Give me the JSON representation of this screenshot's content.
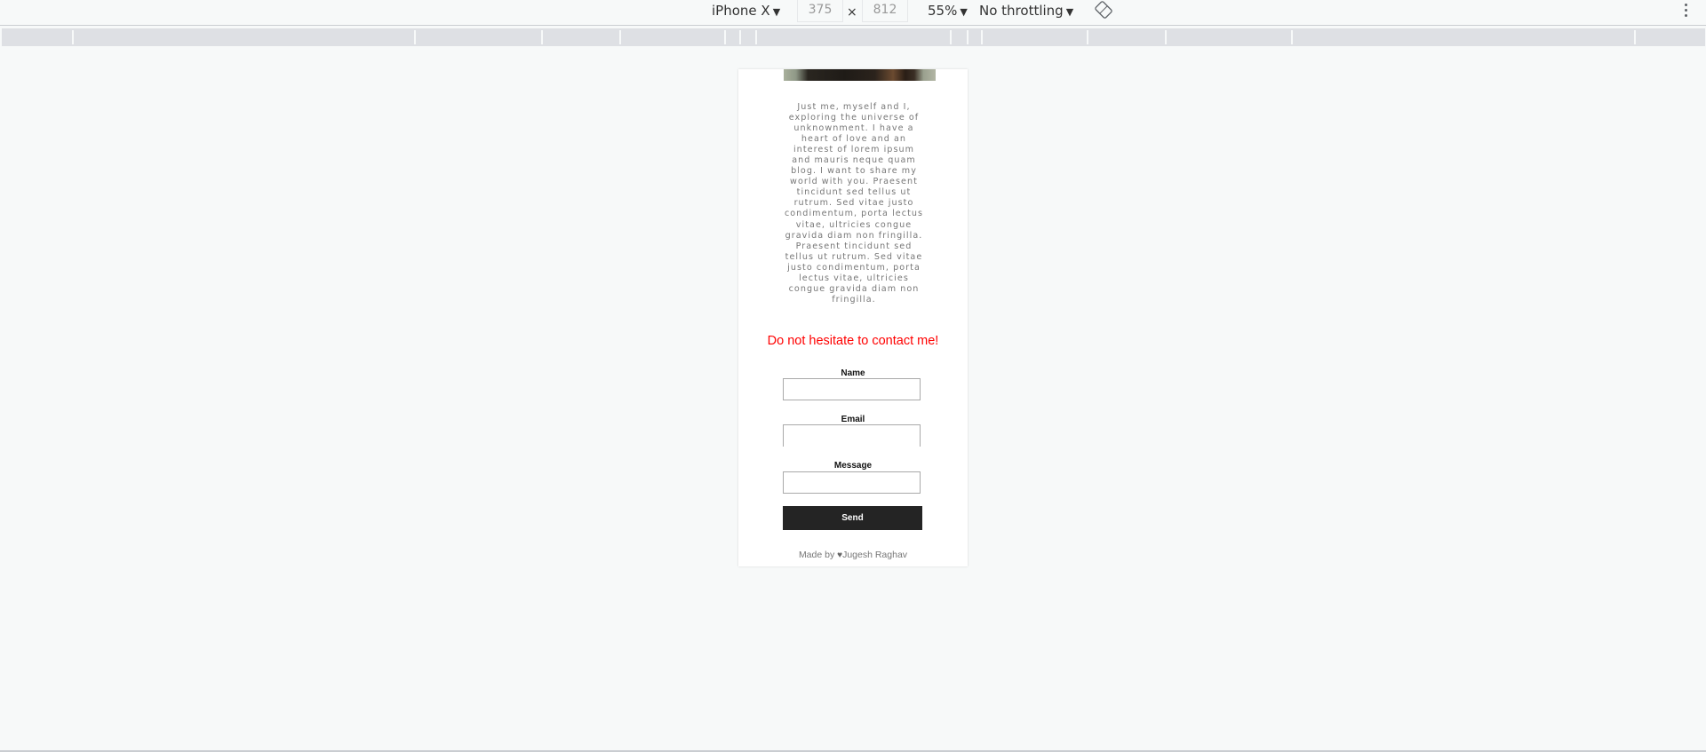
{
  "devtools_toolbar": {
    "device": "iPhone X",
    "width": "375",
    "height": "812",
    "times": "×",
    "zoom": "55%",
    "throttling": "No throttling",
    "caret": "▼",
    "rotate_icon": "rotate-icon",
    "more_icon": "more-vertical-icon"
  },
  "page": {
    "bio": "Just me, myself and I, exploring the universe of unknownment. I have a heart of love and an interest of lorem ipsum and mauris neque quam blog. I want to share my world with you. Praesent tincidunt sed tellus ut rutrum. Sed vitae justo condimentum, porta lectus vitae, ultricies congue gravida diam non fringilla. Praesent tincidunt sed tellus ut rutrum. Sed vitae justo condimentum, porta lectus vitae, ultricies congue gravida diam non fringilla.",
    "contact_heading": "Do not hesitate to contact me!",
    "form": {
      "name_label": "Name",
      "name_value": "",
      "email_label": "Email",
      "email_value": "",
      "message_label": "Message",
      "message_value": "",
      "send_label": "Send"
    },
    "footer": {
      "prefix": "Made by ",
      "heart": "♥",
      "author": "Jugesh Raghav"
    }
  },
  "colors": {
    "heading": "#ff0000",
    "button_bg": "#242424",
    "body_text": "#777777"
  }
}
